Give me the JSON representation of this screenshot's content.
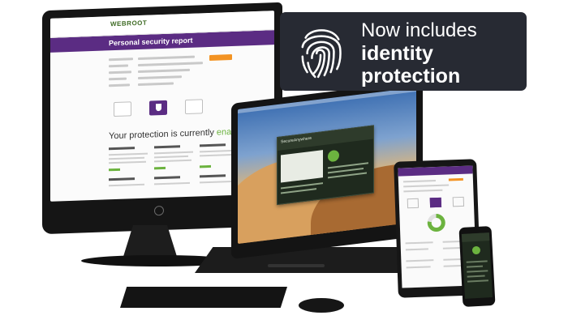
{
  "banner": {
    "line1": "Now includes",
    "line2": "identity",
    "line3": "protection",
    "icon": "fingerprint-icon",
    "background_color": "#272a33",
    "text_color": "#ffffff"
  },
  "desktop_screen": {
    "brand": "WEBROOT",
    "section_title": "Personal security report",
    "status_prefix": "Your protection is currently",
    "status_value": "enabled",
    "accent_color": "#5b2c83",
    "status_color": "#6cb33f",
    "button_color": "#f39323"
  },
  "laptop_screen": {
    "app_title": "SecureAnywhere"
  }
}
